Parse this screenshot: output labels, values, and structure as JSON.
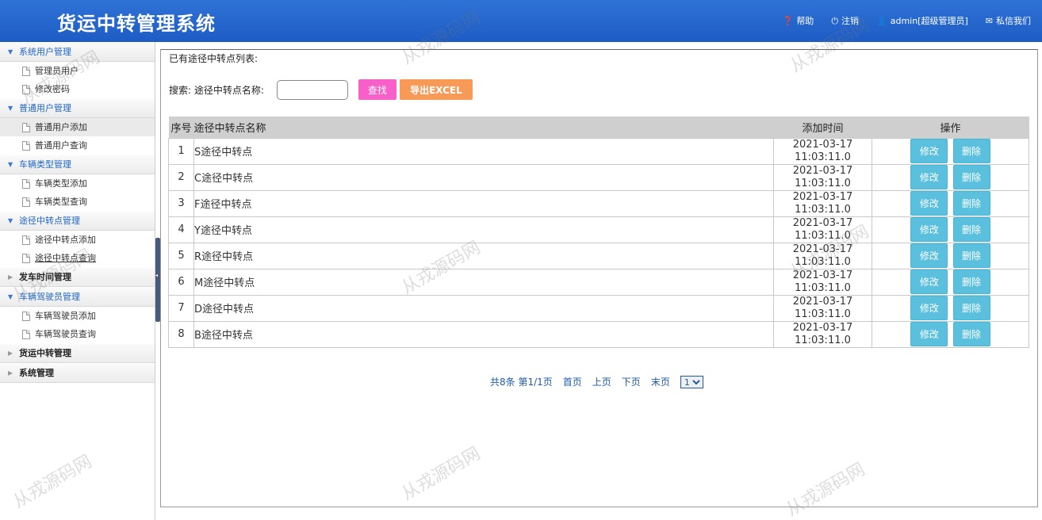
{
  "app_title": "货运中转管理系统",
  "header_links": [
    {
      "icon": "question-icon",
      "glyph": "❓",
      "label": "帮助"
    },
    {
      "icon": "power-icon",
      "glyph": "⏻",
      "label": "注销"
    },
    {
      "icon": "user-icon",
      "glyph": "👤",
      "label": "admin[超级管理员]"
    },
    {
      "icon": "mail-icon",
      "glyph": "✉",
      "label": "私信我们"
    }
  ],
  "sidebar": {
    "groups": [
      {
        "label": "系统用户管理",
        "open": true,
        "items": [
          "管理员用户",
          "修改密码"
        ]
      },
      {
        "label": "普通用户管理",
        "open": true,
        "items": [
          "普通用户添加",
          "普通用户查询"
        ]
      },
      {
        "label": "车辆类型管理",
        "open": true,
        "items": [
          "车辆类型添加",
          "车辆类型查询"
        ]
      },
      {
        "label": "途径中转点管理",
        "open": true,
        "items": [
          "途径中转点添加",
          "途径中转点查询"
        ]
      },
      {
        "label": "发车时间管理",
        "open": false,
        "items": []
      },
      {
        "label": "车辆驾驶员管理",
        "open": true,
        "items": [
          "车辆驾驶员添加",
          "车辆驾驶员查询"
        ]
      },
      {
        "label": "货运中转管理",
        "open": false,
        "items": []
      },
      {
        "label": "系统管理",
        "open": false,
        "items": []
      }
    ]
  },
  "main": {
    "heading": "已有途径中转点列表:",
    "search_label": "搜索: 途径中转点名称:",
    "search_value": "",
    "find_label": "查找",
    "export_label": "导出EXCEL",
    "columns": [
      "序号",
      "途径中转点名称",
      "添加时间",
      "操作"
    ],
    "rows": [
      {
        "idx": "1",
        "name": "S途径中转点",
        "date": "2021-03-17",
        "time": "11:03:11.0"
      },
      {
        "idx": "2",
        "name": "C途径中转点",
        "date": "2021-03-17",
        "time": "11:03:11.0"
      },
      {
        "idx": "3",
        "name": "F途径中转点",
        "date": "2021-03-17",
        "time": "11:03:11.0"
      },
      {
        "idx": "4",
        "name": "Y途径中转点",
        "date": "2021-03-17",
        "time": "11:03:11.0"
      },
      {
        "idx": "5",
        "name": "R途径中转点",
        "date": "2021-03-17",
        "time": "11:03:11.0"
      },
      {
        "idx": "6",
        "name": "M途径中转点",
        "date": "2021-03-17",
        "time": "11:03:11.0"
      },
      {
        "idx": "7",
        "name": "D途径中转点",
        "date": "2021-03-17",
        "time": "11:03:11.0"
      },
      {
        "idx": "8",
        "name": "B途径中转点",
        "date": "2021-03-17",
        "time": "11:03:11.0"
      }
    ],
    "edit_label": "修改",
    "delete_label": "删除",
    "pager": {
      "info": "共8条 第1/1页",
      "first": "首页",
      "prev": "上页",
      "next": "下页",
      "last": "末页",
      "page_options": [
        "1"
      ],
      "selected_page": "1"
    }
  },
  "watermark": "从戎源码网"
}
